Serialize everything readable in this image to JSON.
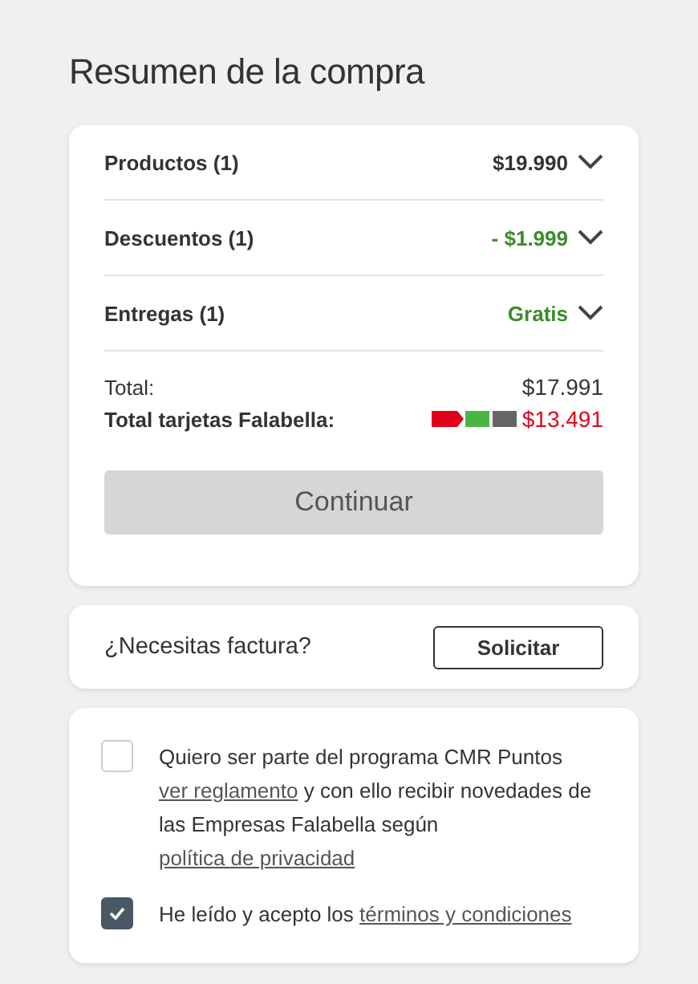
{
  "title": "Resumen de la compra",
  "summary_rows": [
    {
      "label": "Productos (1)",
      "value": "$19.990",
      "color": "#333333",
      "expanded": false
    },
    {
      "label": "Descuentos (1)",
      "value": "- $1.999",
      "color": "#3b8c2a",
      "expanded": false
    },
    {
      "label": "Entregas (1)",
      "value": "Gratis",
      "color": "#3b8c2a",
      "expanded": false
    }
  ],
  "total": {
    "label": "Total:",
    "value": "$17.991"
  },
  "card_total": {
    "label": "Total tarjetas Falabella:",
    "value": "$13.491"
  },
  "continue_button": {
    "label": "Continuar",
    "disabled": true
  },
  "invoice": {
    "question": "¿Necesitas factura?",
    "button": "Solicitar"
  },
  "consents": [
    {
      "checked": false,
      "parts": [
        {
          "text": "Quiero ser parte del programa CMR Puntos ",
          "link": false
        },
        {
          "text": "ver reglamento",
          "link": true
        },
        {
          "text": " y con ello recibir novedades de las Empresas Falabella según ",
          "link": false
        },
        {
          "text": "política de privacidad",
          "link": true
        }
      ]
    },
    {
      "checked": true,
      "parts": [
        {
          "text": "He leído y acepto los ",
          "link": false
        },
        {
          "text": "términos y condiciones",
          "link": true
        }
      ]
    }
  ]
}
